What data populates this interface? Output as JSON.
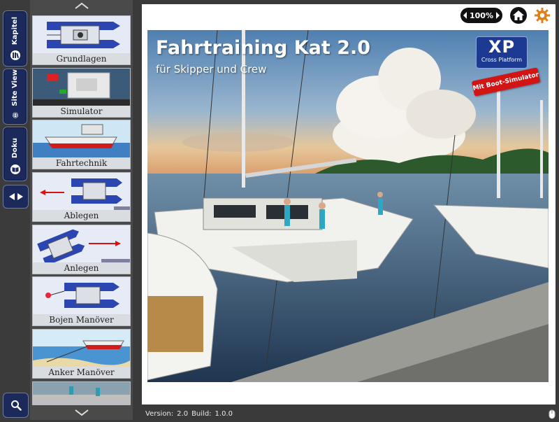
{
  "rail": {
    "tabs": [
      {
        "label": "Kapitel",
        "icon": "books-icon"
      },
      {
        "label": "Site View",
        "icon": "globe-icon"
      },
      {
        "label": "Doku",
        "icon": "book-icon"
      }
    ]
  },
  "chapters": [
    {
      "label": "Grundlagen"
    },
    {
      "label": "Simulator"
    },
    {
      "label": "Fahrtechnik"
    },
    {
      "label": "Ablegen"
    },
    {
      "label": "Anlegen"
    },
    {
      "label": "Bojen Manöver"
    },
    {
      "label": "Anker Manöver"
    }
  ],
  "toolbar": {
    "zoom": "100%"
  },
  "cover": {
    "title": "Fahrtraining Kat 2.0",
    "subtitle": "für Skipper und Crew",
    "logo_text": "XP",
    "logo_subtext": "Cross Platform",
    "badge": "Mit Boot-Simulator"
  },
  "status": {
    "version_label": "Version:",
    "version": "2.0",
    "build_label": "Build:",
    "build": "1.0.0"
  },
  "colors": {
    "rail_button": "#1b2a5a",
    "badge_red": "#d31414",
    "logo_blue": "#1c3a92"
  }
}
